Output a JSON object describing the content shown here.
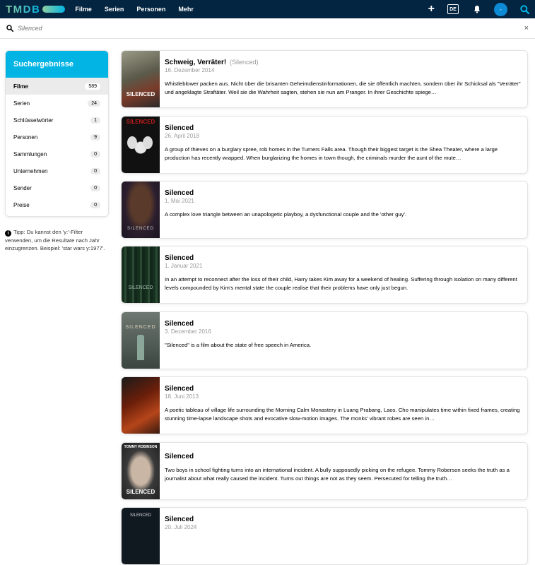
{
  "header": {
    "logo": "TMDB",
    "nav": [
      "Filme",
      "Serien",
      "Personen",
      "Mehr"
    ],
    "add_label": "+",
    "language": "DE",
    "avatar_letter": "-",
    "icons": [
      "plus-icon",
      "bell-icon",
      "search-icon"
    ]
  },
  "search": {
    "value": "",
    "placeholder": "Silenced",
    "clear_label": "×"
  },
  "sidebar": {
    "title": "Suchergebnisse",
    "items": [
      {
        "label": "Filme",
        "count": "589"
      },
      {
        "label": "Serien",
        "count": "24"
      },
      {
        "label": "Schlüsselwörter",
        "count": "1"
      },
      {
        "label": "Personen",
        "count": "9"
      },
      {
        "label": "Sammlungen",
        "count": "0"
      },
      {
        "label": "Unternehmen",
        "count": "0"
      },
      {
        "label": "Sender",
        "count": "0"
      },
      {
        "label": "Preise",
        "count": "0"
      }
    ]
  },
  "tip": "Tipp: Du kannst den 'y:'-Filter verwenden, um die Resultate nach Jahr einzugrenzen. Beispiel: 'star wars y:1977'.",
  "results": [
    {
      "title": "Schweig, Verräter!",
      "original": "(Silenced)",
      "date": "16. Dezember 2014",
      "overview": "Whistleblower packen aus. Nicht über die brisanten Geheimdienstinformationen, die sie öffentlich machten, sondern über ihr Schicksal als \"Verräter\" und angeklagte Straftäter. Weil sie die Wahrheit sagten, stehen sie nun am Pranger. In ihrer Geschichte spiege…",
      "poster_text": "SILENCED",
      "poster_color": "#6b6a5a"
    },
    {
      "title": "Silenced",
      "original": "",
      "date": "26. April 2018",
      "overview": "A group of thieves on a burglary spree, rob homes in the Turners Falls area. Though their biggest target is the Shea Theater, where a large production has recently wrapped. When burglarizing the homes in town though, the criminals murder the aunt of the mute…",
      "poster_text": "SILENCED",
      "poster_color": "#1a1a1a"
    },
    {
      "title": "Silenced",
      "original": "",
      "date": "1. Mai 2021",
      "overview": "A complex love triangle between an unapologetic playboy, a dysfunctional couple and the 'other guy'.",
      "poster_text": "SILENCED",
      "poster_color": "#2c1f2e"
    },
    {
      "title": "Silenced",
      "original": "",
      "date": "1. Januar 2021",
      "overview": "In an attempt to reconnect after the loss of their child, Harry takes Kim away for a weekend of healing. Suffering through isolation on many different levels compounded by Kim's mental state the couple realise that their problems have only just begun.",
      "poster_text": "SILENCED",
      "poster_color": "#1e3a2a"
    },
    {
      "title": "Silenced",
      "original": "",
      "date": "3. Dezember 2016",
      "overview": "\"Silenced\" is a film about the state of free speech in America.",
      "poster_text": "SILENCED",
      "poster_color": "#5a6560"
    },
    {
      "title": "Silenced",
      "original": "",
      "date": "18. Juni 2013",
      "overview": "A poetic tableau of village life surrounding the Morning Calm Monastery in Luang Prabang, Laos. Cho manipulates time within fixed frames, creating stunning time-lapse landscape shots and evocative slow-motion images. The monks' vibrant robes are seen in…",
      "poster_text": "",
      "poster_color": "#8a2a10"
    },
    {
      "title": "Silenced",
      "original": "",
      "date": "",
      "overview": "Two boys in school fighting turns into an international incident. A bully supposedly picking on the refugee. Tommy Roberson seeks the truth as a journalist about what really caused the incident. Turns out things are not as they seem. Persecuted for telling the truth…",
      "poster_text": "SILENCED",
      "poster_top": "TOMMY ROBINSON",
      "poster_color": "#3a3a3a"
    },
    {
      "title": "Silenced",
      "original": "",
      "date": "20. Juli 2024",
      "overview": "",
      "poster_text": "SILENCED",
      "poster_color": "#101820"
    }
  ]
}
